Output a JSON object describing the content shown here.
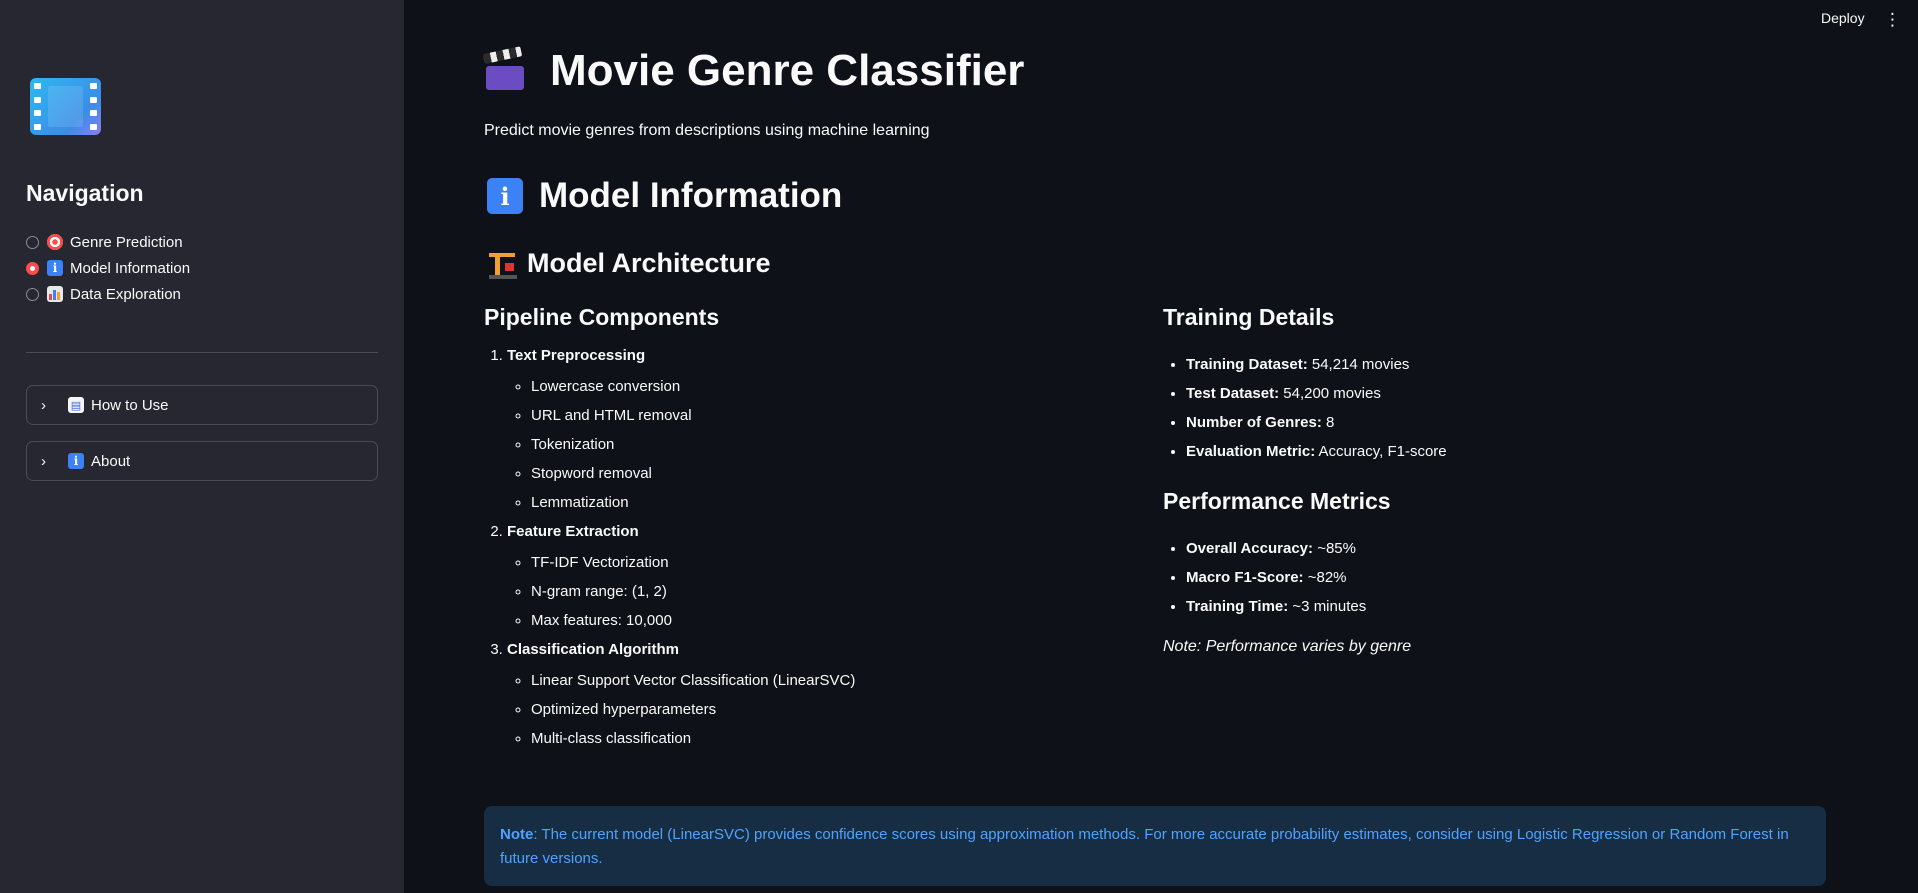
{
  "header": {
    "deploy_label": "Deploy",
    "menu_icon": "kebab-menu-icon"
  },
  "sidebar": {
    "logo_icon": "film-frames-icon",
    "nav_title": "Navigation",
    "nav_items": [
      {
        "icon": "target-icon",
        "label": "Genre Prediction",
        "selected": false
      },
      {
        "icon": "info-icon",
        "label": "Model Information",
        "selected": true
      },
      {
        "icon": "bar-chart-icon",
        "label": "Data Exploration",
        "selected": false
      }
    ],
    "expanders": [
      {
        "icon": "book-icon",
        "label": "How to Use"
      },
      {
        "icon": "info-icon",
        "label": "About"
      }
    ]
  },
  "main": {
    "title": "Movie Genre Classifier",
    "subtitle": "Predict movie genres from descriptions using machine learning",
    "section_title": "Model Information",
    "architecture_title": "Model Architecture",
    "pipeline": {
      "heading": "Pipeline Components",
      "steps": [
        {
          "title": "Text Preprocessing",
          "items": [
            "Lowercase conversion",
            "URL and HTML removal",
            "Tokenization",
            "Stopword removal",
            "Lemmatization"
          ]
        },
        {
          "title": "Feature Extraction",
          "items": [
            "TF-IDF Vectorization",
            "N-gram range: (1, 2)",
            "Max features: 10,000"
          ]
        },
        {
          "title": "Classification Algorithm",
          "items": [
            "Linear Support Vector Classification (LinearSVC)",
            "Optimized hyperparameters",
            "Multi-class classification"
          ]
        }
      ]
    },
    "training": {
      "heading": "Training Details",
      "items": [
        {
          "key": "Training Dataset",
          "value": "54,214 movies"
        },
        {
          "key": "Test Dataset",
          "value": "54,200 movies"
        },
        {
          "key": "Number of Genres",
          "value": "8"
        },
        {
          "key": "Evaluation Metric",
          "value": "Accuracy, F1-score"
        }
      ]
    },
    "performance": {
      "heading": "Performance Metrics",
      "items": [
        {
          "key": "Overall Accuracy",
          "value": "~85%"
        },
        {
          "key": "Macro F1-Score",
          "value": "~82%"
        },
        {
          "key": "Training Time",
          "value": "~3 minutes"
        }
      ],
      "note": "Note: Performance varies by genre"
    },
    "alert": {
      "label": "Note",
      "text": ": The current model (LinearSVC) provides confidence scores using approximation methods. For more accurate probability estimates, consider using Logistic Regression or Random Forest in future versions."
    }
  }
}
